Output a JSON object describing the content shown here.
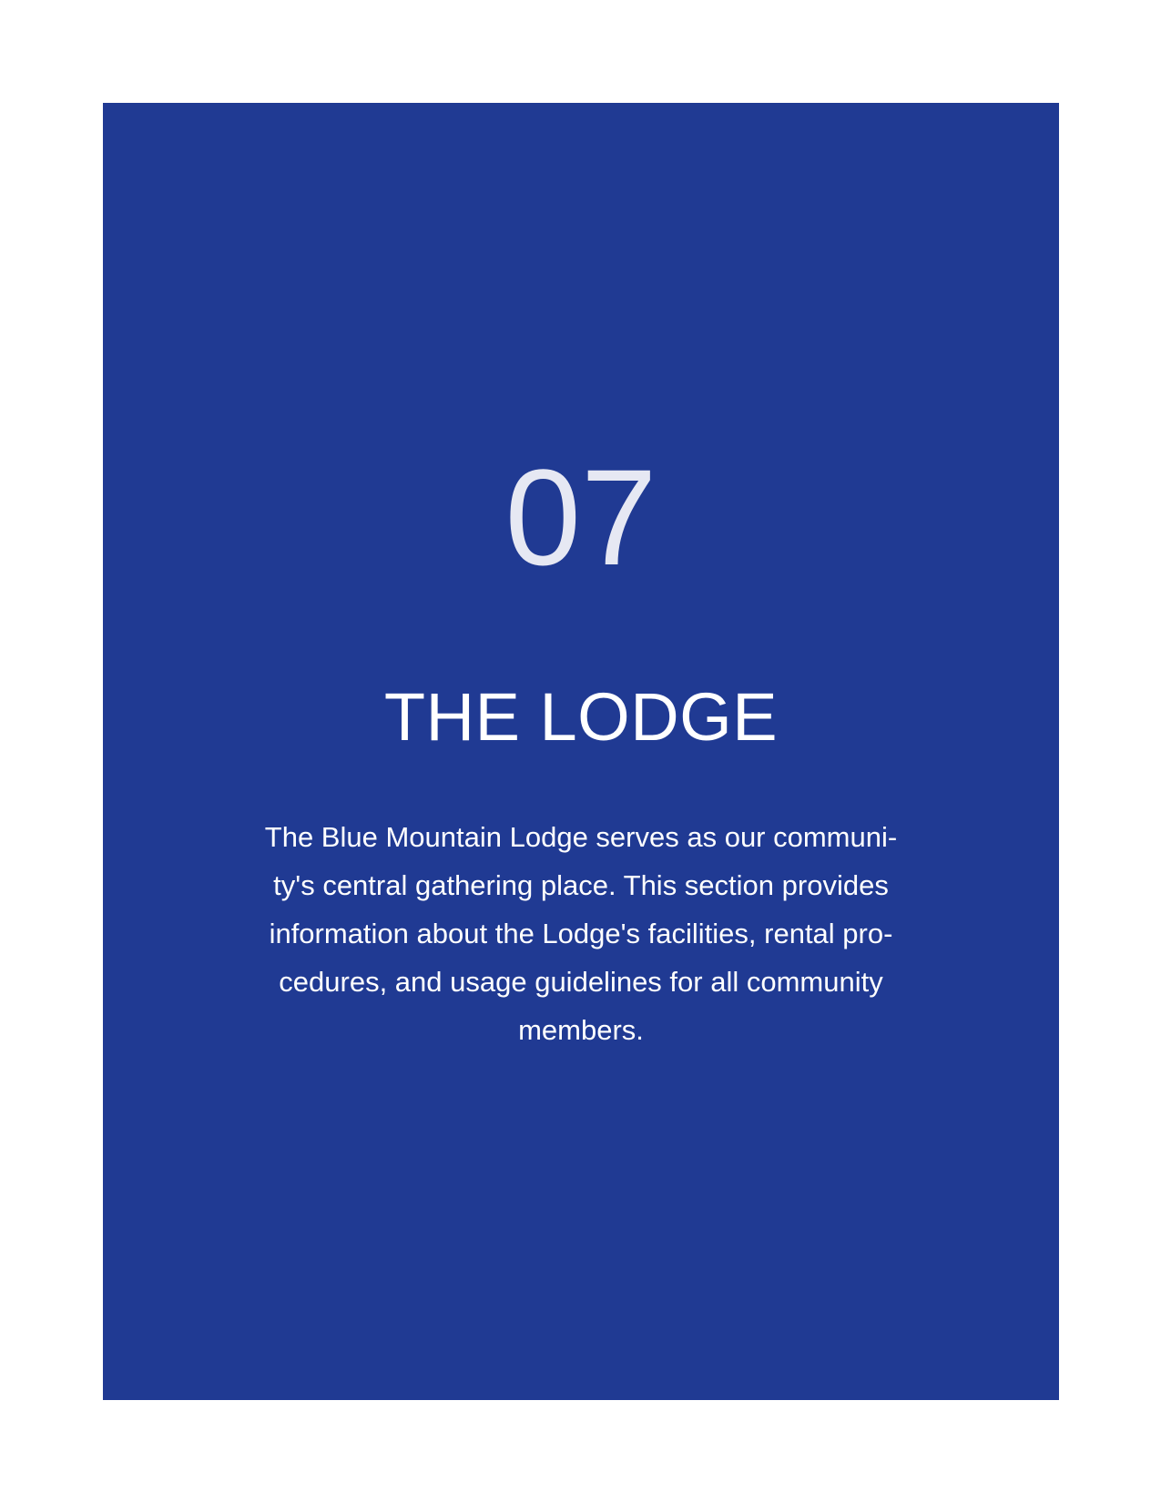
{
  "colors": {
    "page_background": "#ffffff",
    "panel_background": "#203a93",
    "number_text": "#e6e8f3",
    "body_text": "#ffffff"
  },
  "section": {
    "number": "07",
    "title": "THE LODGE",
    "intro_lines": [
      "The Blue Mountain Lodge serves as our communi-",
      "ty's central gathering place. This section provides",
      "information about the Lodge's facilities, rental pro-",
      "cedures, and usage guidelines for all community",
      "members."
    ]
  }
}
